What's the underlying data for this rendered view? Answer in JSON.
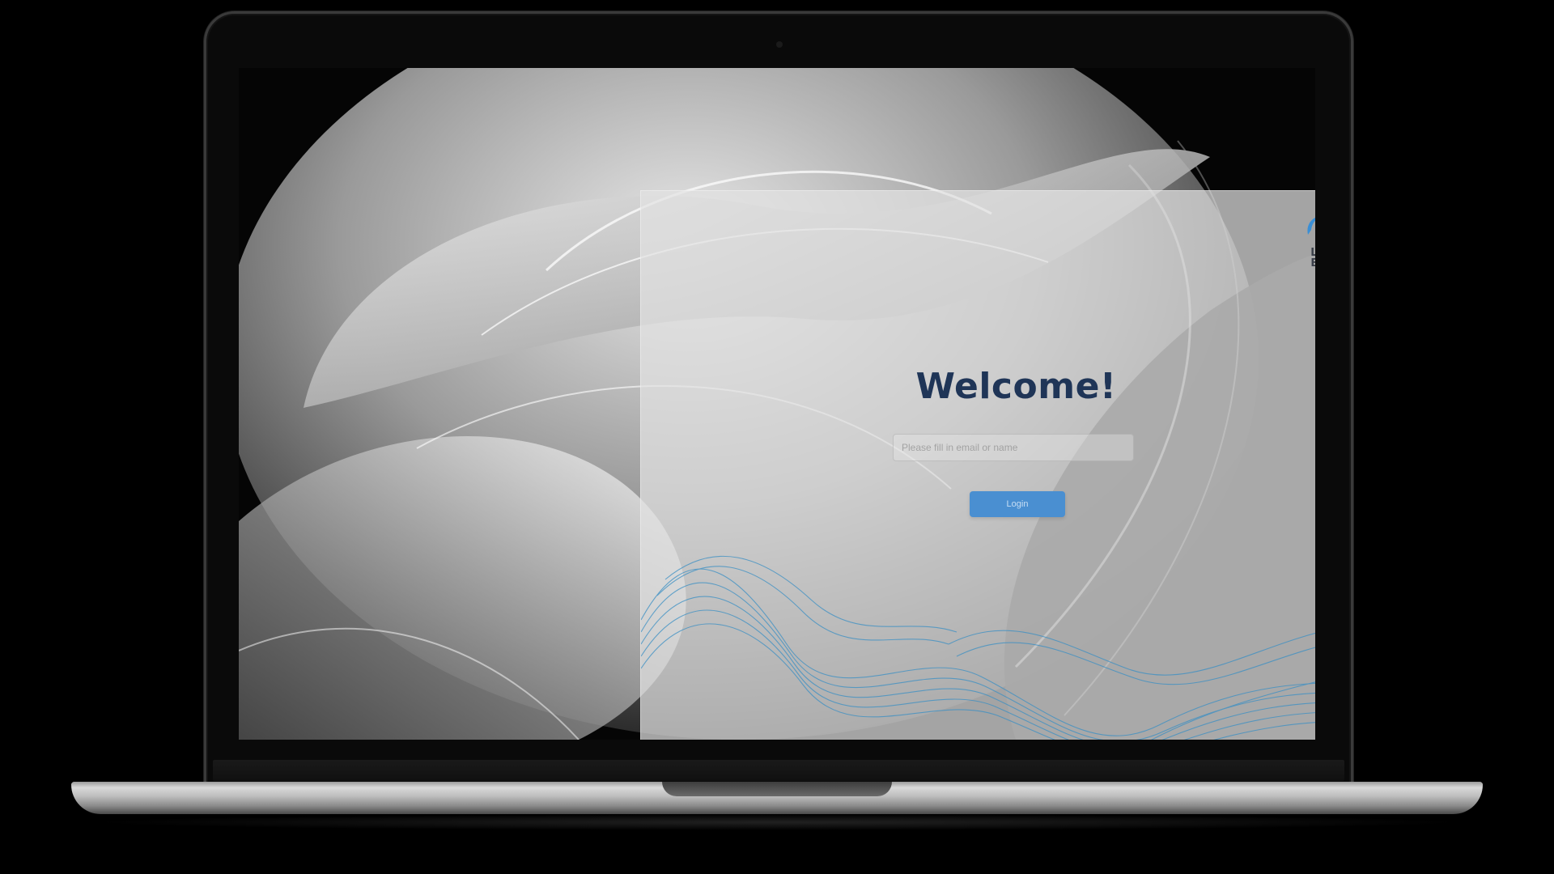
{
  "login": {
    "title": "Welcome!",
    "email_placeholder": "Please fill in email or name",
    "button_label": "Login"
  },
  "brand": {
    "logo_line1": "LUXURY",
    "logo_line2": "BUBBLE",
    "logo_colors": [
      "#2bb3d6",
      "#3a8fd6"
    ]
  },
  "colors": {
    "title": "#1f3557",
    "button": "#4a8fd1",
    "card_waves": "#3a8fc4"
  },
  "icons": {
    "logo": "bubble-logo-icon"
  }
}
